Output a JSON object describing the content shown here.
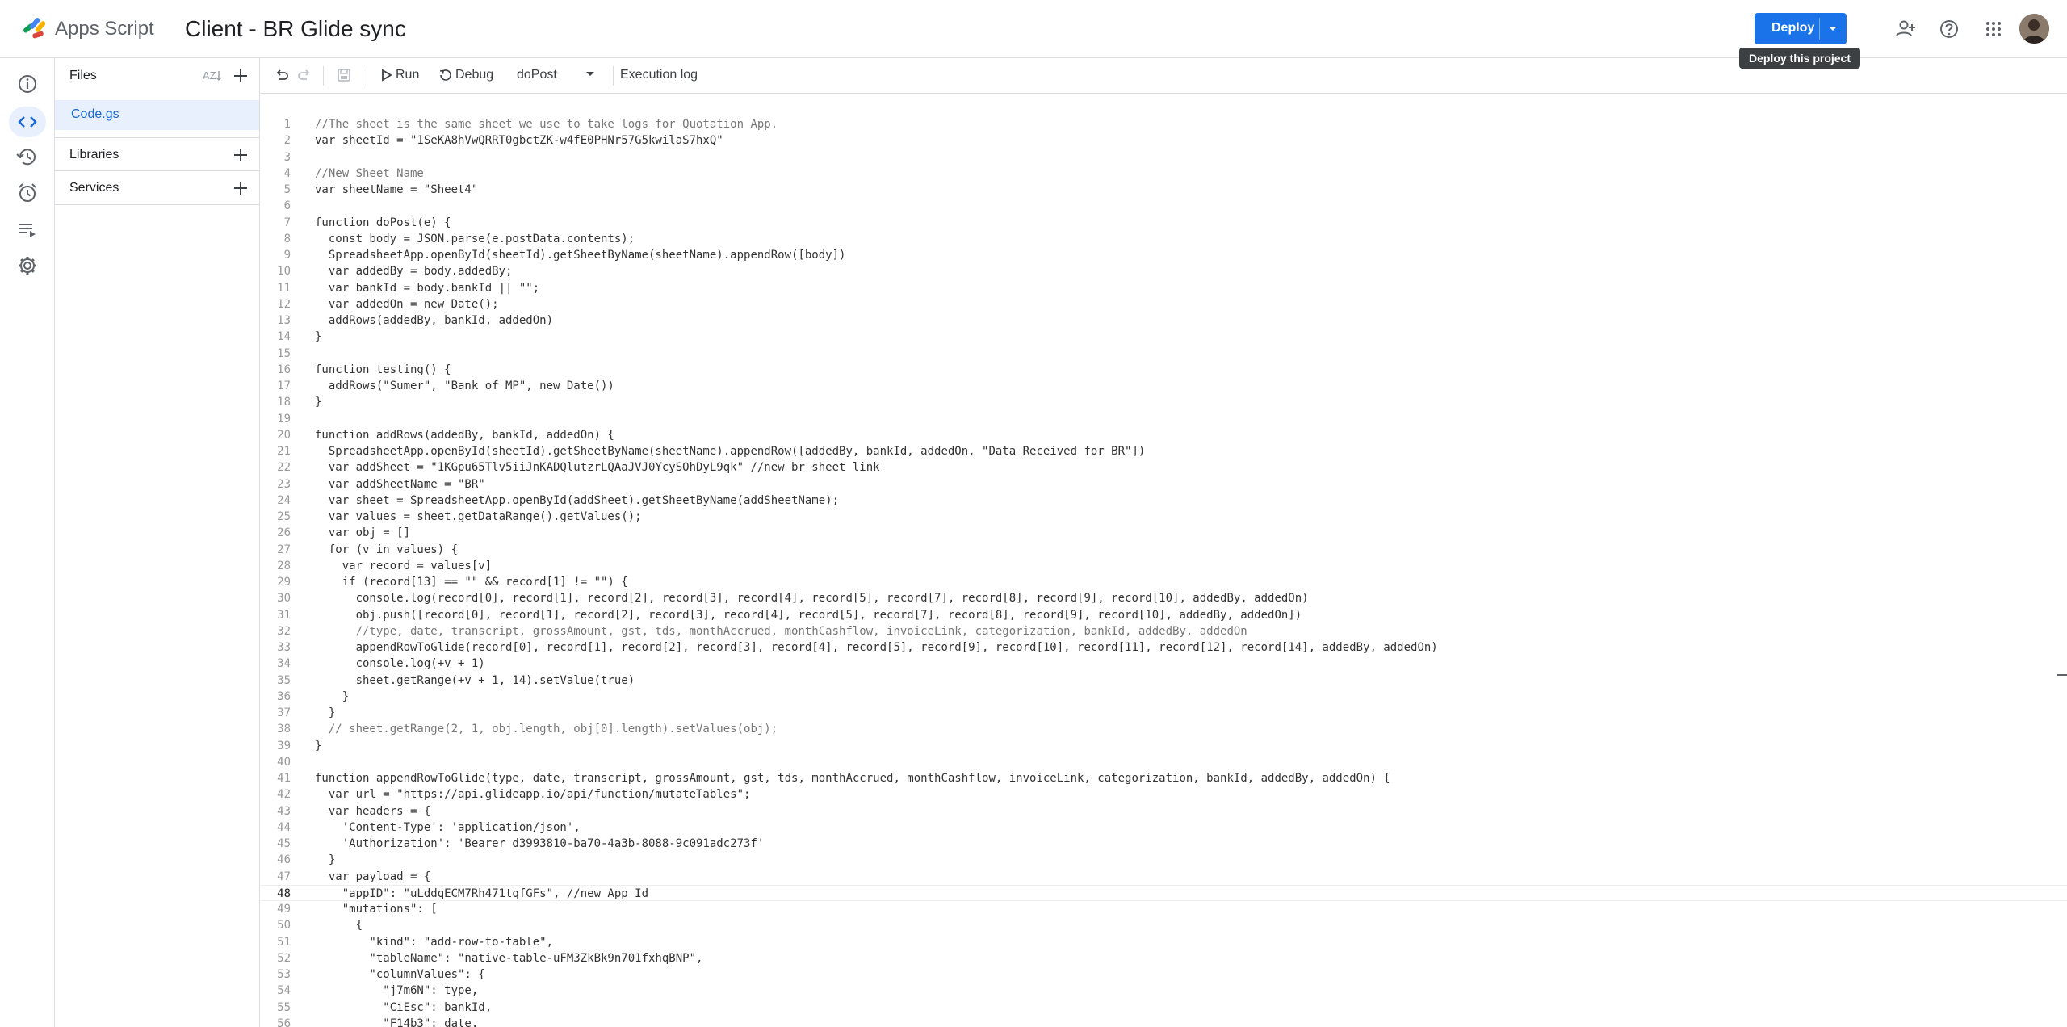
{
  "header": {
    "app_name": "Apps Script",
    "project_title": "Client - BR Glide sync",
    "deploy_label": "Deploy",
    "tooltip": "Deploy this project",
    "brand_color": "#1a73e8"
  },
  "rail": {
    "items": [
      "info-icon",
      "code-icon",
      "history-icon",
      "alarm-icon",
      "executions-icon",
      "settings-icon"
    ],
    "active": "code-icon"
  },
  "files_panel": {
    "title": "Files",
    "files": [
      {
        "name": "Code.gs",
        "selected": true
      }
    ],
    "libraries_label": "Libraries",
    "services_label": "Services"
  },
  "toolbar": {
    "run_label": "Run",
    "debug_label": "Debug",
    "function_selected": "doPost",
    "execution_log_label": "Execution log"
  },
  "editor": {
    "current_line": 48,
    "lines": [
      "//The sheet is the same sheet we use to take logs for Quotation App.",
      "var sheetId = \"1SeKA8hVwQRRT0gbctZK-w4fE0PHNr57G5kwilaS7hxQ\"",
      "",
      "//New Sheet Name",
      "var sheetName = \"Sheet4\"",
      "",
      "function doPost(e) {",
      "  const body = JSON.parse(e.postData.contents);",
      "  SpreadsheetApp.openById(sheetId).getSheetByName(sheetName).appendRow([body])",
      "  var addedBy = body.addedBy;",
      "  var bankId = body.bankId || \"\";",
      "  var addedOn = new Date();",
      "  addRows(addedBy, bankId, addedOn)",
      "}",
      "",
      "function testing() {",
      "  addRows(\"Sumer\", \"Bank of MP\", new Date())",
      "}",
      "",
      "function addRows(addedBy, bankId, addedOn) {",
      "  SpreadsheetApp.openById(sheetId).getSheetByName(sheetName).appendRow([addedBy, bankId, addedOn, \"Data Received for BR\"])",
      "  var addSheet = \"1KGpu65Tlv5iiJnKADQlutzrLQAaJVJ0YcySOhDyL9qk\" //new br sheet link",
      "  var addSheetName = \"BR\"",
      "  var sheet = SpreadsheetApp.openById(addSheet).getSheetByName(addSheetName);",
      "  var values = sheet.getDataRange().getValues();",
      "  var obj = []",
      "  for (v in values) {",
      "    var record = values[v]",
      "    if (record[13] == \"\" && record[1] != \"\") {",
      "      console.log(record[0], record[1], record[2], record[3], record[4], record[5], record[7], record[8], record[9], record[10], addedBy, addedOn)",
      "      obj.push([record[0], record[1], record[2], record[3], record[4], record[5], record[7], record[8], record[9], record[10], addedBy, addedOn])",
      "      //type, date, transcript, grossAmount, gst, tds, monthAccrued, monthCashflow, invoiceLink, categorization, bankId, addedBy, addedOn",
      "      appendRowToGlide(record[0], record[1], record[2], record[3], record[4], record[5], record[9], record[10], record[11], record[12], record[14], addedBy, addedOn)",
      "      console.log(+v + 1)",
      "      sheet.getRange(+v + 1, 14).setValue(true)",
      "    }",
      "  }",
      "  // sheet.getRange(2, 1, obj.length, obj[0].length).setValues(obj);",
      "}",
      "",
      "function appendRowToGlide(type, date, transcript, grossAmount, gst, tds, monthAccrued, monthCashflow, invoiceLink, categorization, bankId, addedBy, addedOn) {",
      "  var url = \"https://api.glideapp.io/api/function/mutateTables\";",
      "  var headers = {",
      "    'Content-Type': 'application/json',",
      "    'Authorization': 'Bearer d3993810-ba70-4a3b-8088-9c091adc273f'",
      "  }",
      "  var payload = {",
      "    \"appID\": \"uLddqECM7Rh471tqfGFs\", //new App Id",
      "    \"mutations\": [",
      "      {",
      "        \"kind\": \"add-row-to-table\",",
      "        \"tableName\": \"native-table-uFM3ZkBk9n701fxhqBNP\",",
      "        \"columnValues\": {",
      "          \"j7m6N\": type,",
      "          \"CiEsc\": bankId,",
      "          \"F14b3\": date,"
    ]
  }
}
